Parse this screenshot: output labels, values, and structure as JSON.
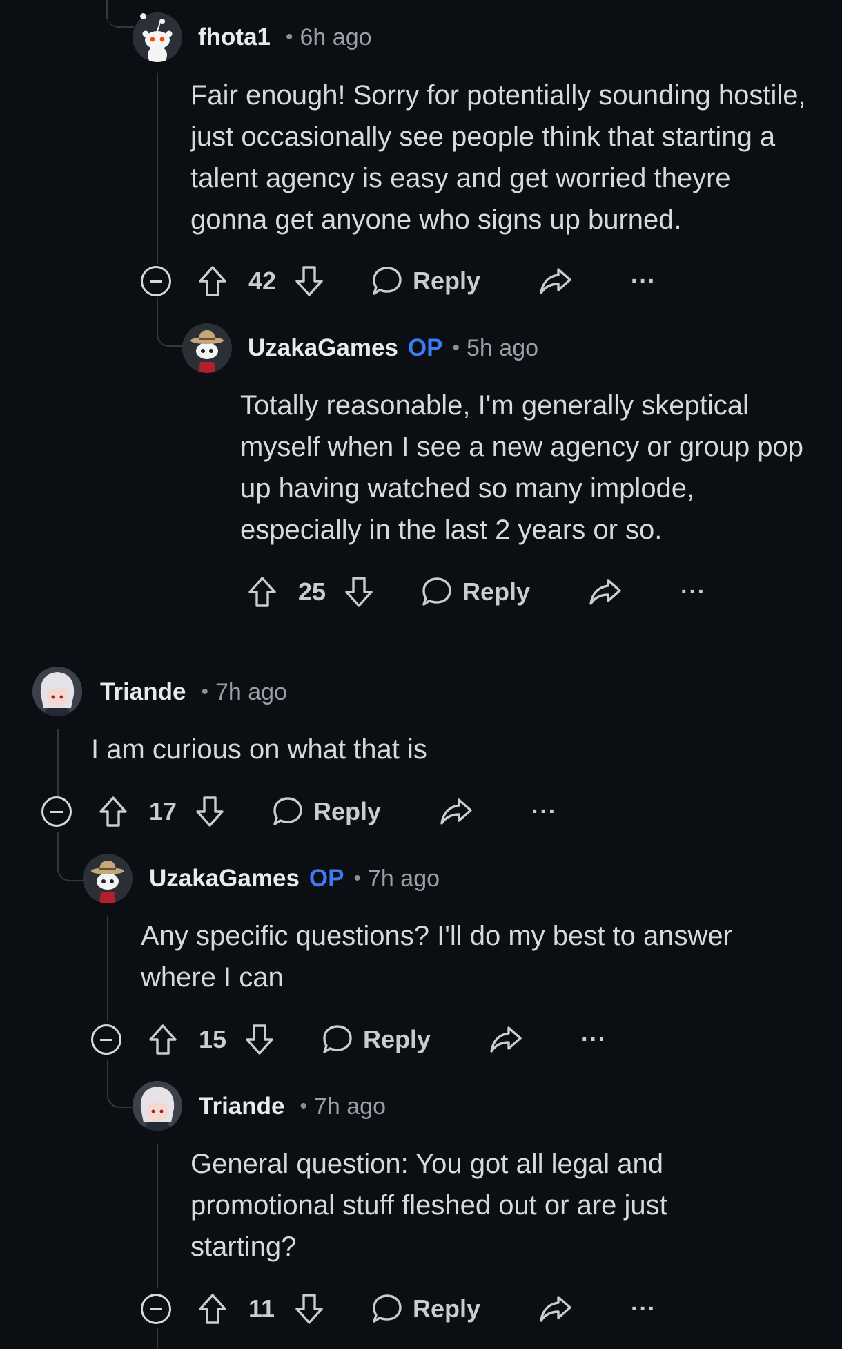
{
  "comments": [
    {
      "username": "fhota1",
      "op": "",
      "time": "6h ago",
      "body": "Fair enough! Sorry for potentially sounding hostile, just occasionally see people think that starting a talent agency is easy and get worried theyre gonna get anyone who signs up burned.",
      "votes": "42",
      "reply_label": "Reply",
      "more_label": "···",
      "avatar": "reddit-snoo-default"
    },
    {
      "username": "UzakaGames",
      "op": "OP",
      "time": "5h ago",
      "body": "Totally reasonable, I'm generally skeptical myself when I see a new agency or group pop up having watched so many implode, especially in the last 2 years or so.",
      "votes": "25",
      "reply_label": "Reply",
      "more_label": "···",
      "avatar": "snoo-cowboy-hat"
    },
    {
      "username": "Triande",
      "op": "",
      "time": "7h ago",
      "body": "I am curious on what that is",
      "votes": "17",
      "reply_label": "Reply",
      "more_label": "···",
      "avatar": "anime-white-hair"
    },
    {
      "username": "UzakaGames",
      "op": "OP",
      "time": "7h ago",
      "body": "Any specific questions? I'll do my best to answer where I can",
      "votes": "15",
      "reply_label": "Reply",
      "more_label": "···",
      "avatar": "snoo-cowboy-hat"
    },
    {
      "username": "Triande",
      "op": "",
      "time": "7h ago",
      "body": "General question: You got all legal and promotional stuff fleshed out or are just starting?",
      "votes": "11",
      "reply_label": "Reply",
      "more_label": "···",
      "avatar": "anime-white-hair"
    }
  ],
  "colors": {
    "background": "#0b0e12",
    "text": "#d7dadc",
    "op_badge": "#3d7bf2",
    "thread_line": "#33383d"
  }
}
